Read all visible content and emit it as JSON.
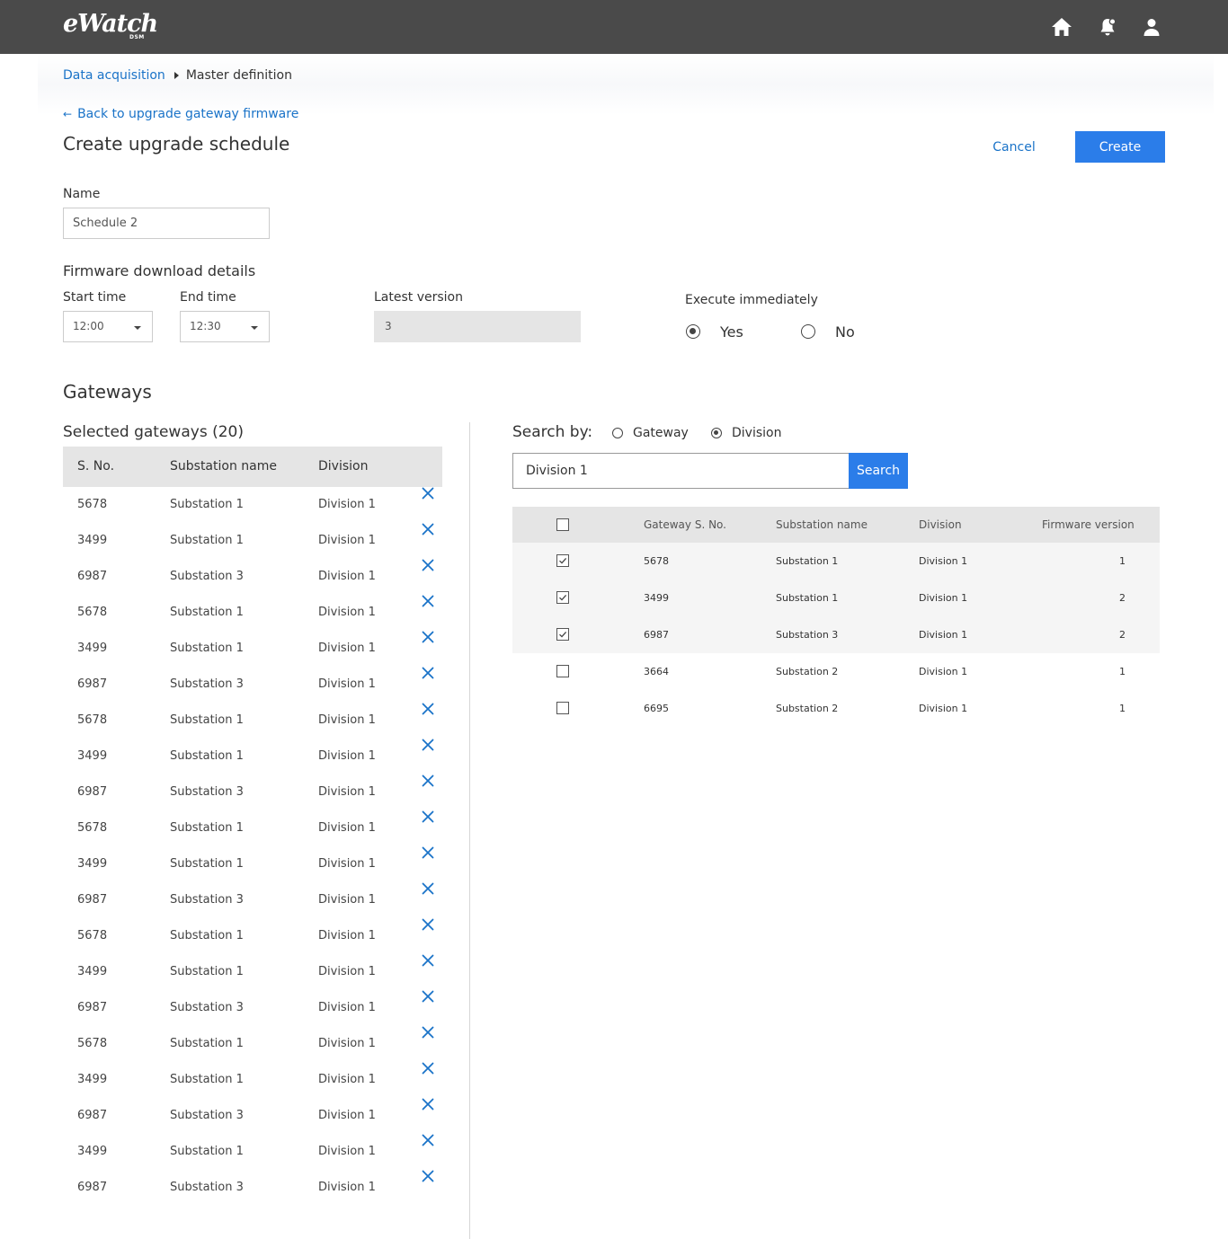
{
  "app": {
    "logo_text": "eWatch",
    "logo_sub": "DSM",
    "icons": [
      "home-icon",
      "bell-icon",
      "user-icon"
    ]
  },
  "breadcrumb": {
    "link": "Data acquisition",
    "current": "Master definition"
  },
  "back_link": "Back to upgrade gateway firmware",
  "page_title": "Create upgrade schedule",
  "actions": {
    "cancel": "Cancel",
    "create": "Create"
  },
  "form": {
    "name_label": "Name",
    "name_value": "Schedule 2",
    "firmware_title": "Firmware download details",
    "start_label": "Start time",
    "start_value": "12:00",
    "end_label": "End time",
    "end_value": "12:30",
    "latest_label": "Latest version",
    "latest_value": "3",
    "execute_label": "Execute immediately",
    "execute_options": [
      {
        "label": "Yes",
        "selected": true
      },
      {
        "label": "No",
        "selected": false
      }
    ]
  },
  "gateways": {
    "title": "Gateways",
    "selected_title": "Selected gateways (20)",
    "columns": [
      "S. No.",
      "Substation name",
      "Division"
    ],
    "rows": [
      [
        "5678",
        "Substation 1",
        "Division 1"
      ],
      [
        "3499",
        "Substation 1",
        "Division 1"
      ],
      [
        "6987",
        "Substation 3",
        "Division 1"
      ],
      [
        "5678",
        "Substation 1",
        "Division 1"
      ],
      [
        "3499",
        "Substation 1",
        "Division 1"
      ],
      [
        "6987",
        "Substation 3",
        "Division 1"
      ],
      [
        "5678",
        "Substation 1",
        "Division 1"
      ],
      [
        "3499",
        "Substation 1",
        "Division 1"
      ],
      [
        "6987",
        "Substation 3",
        "Division 1"
      ],
      [
        "5678",
        "Substation 1",
        "Division 1"
      ],
      [
        "3499",
        "Substation 1",
        "Division 1"
      ],
      [
        "6987",
        "Substation 3",
        "Division 1"
      ],
      [
        "5678",
        "Substation 1",
        "Division 1"
      ],
      [
        "3499",
        "Substation 1",
        "Division 1"
      ],
      [
        "6987",
        "Substation 3",
        "Division 1"
      ],
      [
        "5678",
        "Substation 1",
        "Division 1"
      ],
      [
        "3499",
        "Substation 1",
        "Division 1"
      ],
      [
        "6987",
        "Substation 3",
        "Division 1"
      ],
      [
        "3499",
        "Substation 1",
        "Division 1"
      ],
      [
        "6987",
        "Substation 3",
        "Division 1"
      ]
    ]
  },
  "search": {
    "label": "Search by:",
    "options": [
      {
        "label": "Gateway",
        "selected": false
      },
      {
        "label": "Division",
        "selected": true
      }
    ],
    "value": "Division 1",
    "button": "Search"
  },
  "results": {
    "columns": [
      "Gateway S. No.",
      "Substation name",
      "Division",
      "Firmware version"
    ],
    "rows": [
      {
        "sno": "5678",
        "substation": "Substation 1",
        "division": "Division 1",
        "firmware": "1",
        "checked": true
      },
      {
        "sno": "3499",
        "substation": "Substation 1",
        "division": "Division 1",
        "firmware": "2",
        "checked": true
      },
      {
        "sno": "6987",
        "substation": "Substation 3",
        "division": "Division 1",
        "firmware": "2",
        "checked": true
      },
      {
        "sno": "3664",
        "substation": "Substation 2",
        "division": "Division 1",
        "firmware": "1",
        "checked": false
      },
      {
        "sno": "6695",
        "substation": "Substation 2",
        "division": "Division 1",
        "firmware": "1",
        "checked": false
      }
    ]
  },
  "colors": {
    "topbar": "#4a4a4a",
    "accent": "#2b7de9",
    "link": "#1a73c8",
    "remove_icon": "#1a73c8"
  }
}
